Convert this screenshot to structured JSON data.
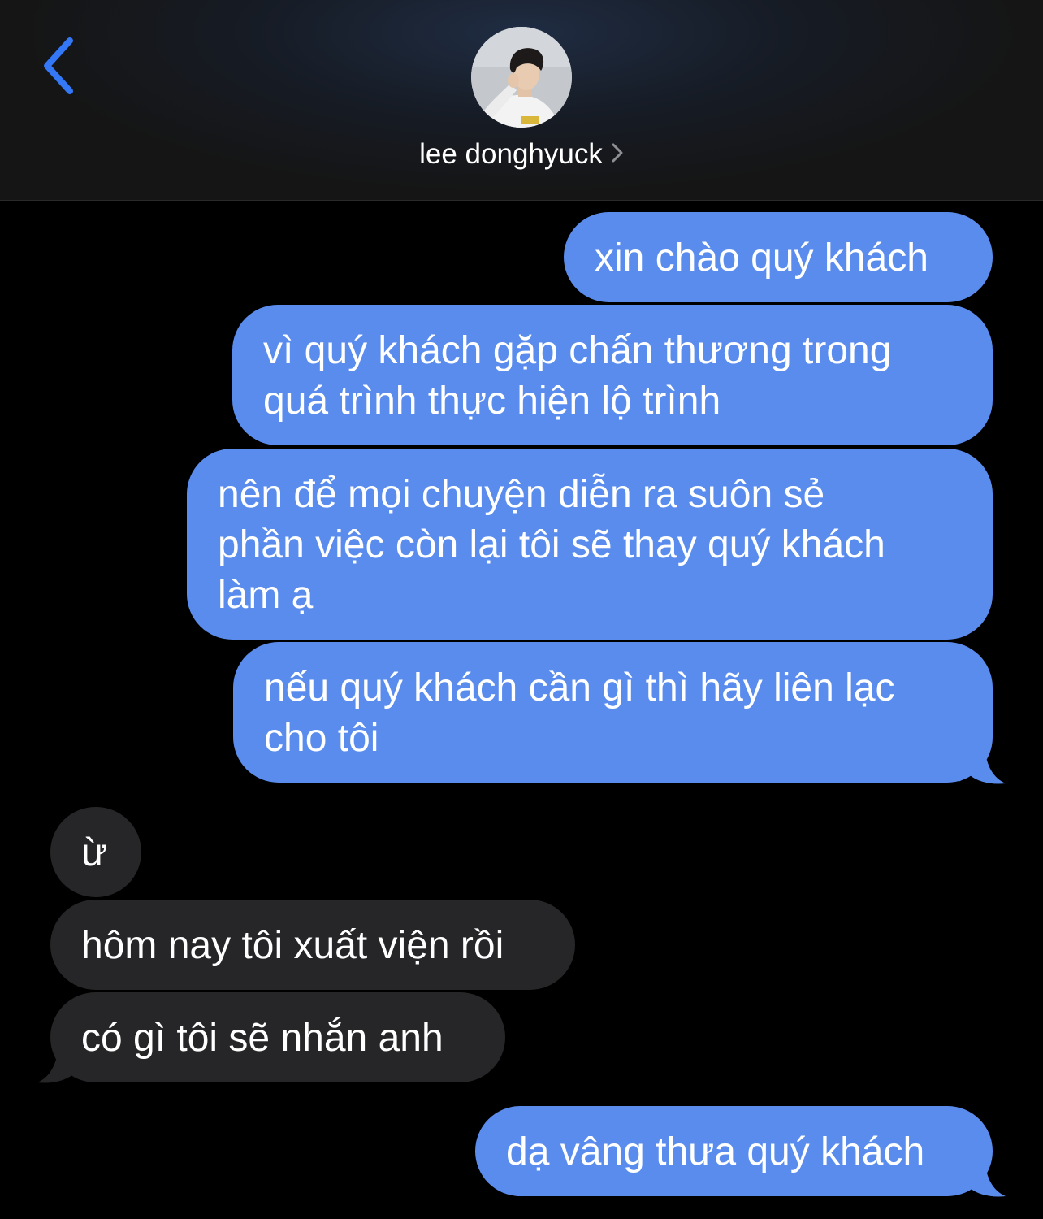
{
  "header": {
    "contact_name": "lee donghyuck",
    "back_icon": "chevron-left-icon",
    "disclosure_icon": "chevron-right-icon",
    "accent_color": "#3478f6"
  },
  "colors": {
    "sent_bubble": "#5a8cee",
    "received_bubble": "#262628",
    "background": "#000000"
  },
  "messages": [
    {
      "direction": "sent",
      "lines": [
        "xin chào quý khách"
      ]
    },
    {
      "direction": "sent",
      "lines": [
        "vì quý khách gặp chấn thương trong",
        "quá trình thực hiện lộ trình"
      ]
    },
    {
      "direction": "sent",
      "lines": [
        "nên để mọi chuyện diễn ra suôn sẻ",
        "phần việc còn lại tôi sẽ thay quý khách",
        "làm ạ"
      ]
    },
    {
      "direction": "sent",
      "lines": [
        "nếu quý khách cần gì thì hãy liên lạc",
        "cho tôi"
      ]
    },
    {
      "direction": "received",
      "lines": [
        "ừ"
      ]
    },
    {
      "direction": "received",
      "lines": [
        "hôm nay tôi xuất viện rồi"
      ]
    },
    {
      "direction": "received",
      "lines": [
        "có gì tôi sẽ nhắn anh"
      ]
    },
    {
      "direction": "sent",
      "lines": [
        "dạ vâng thưa quý khách"
      ]
    }
  ]
}
